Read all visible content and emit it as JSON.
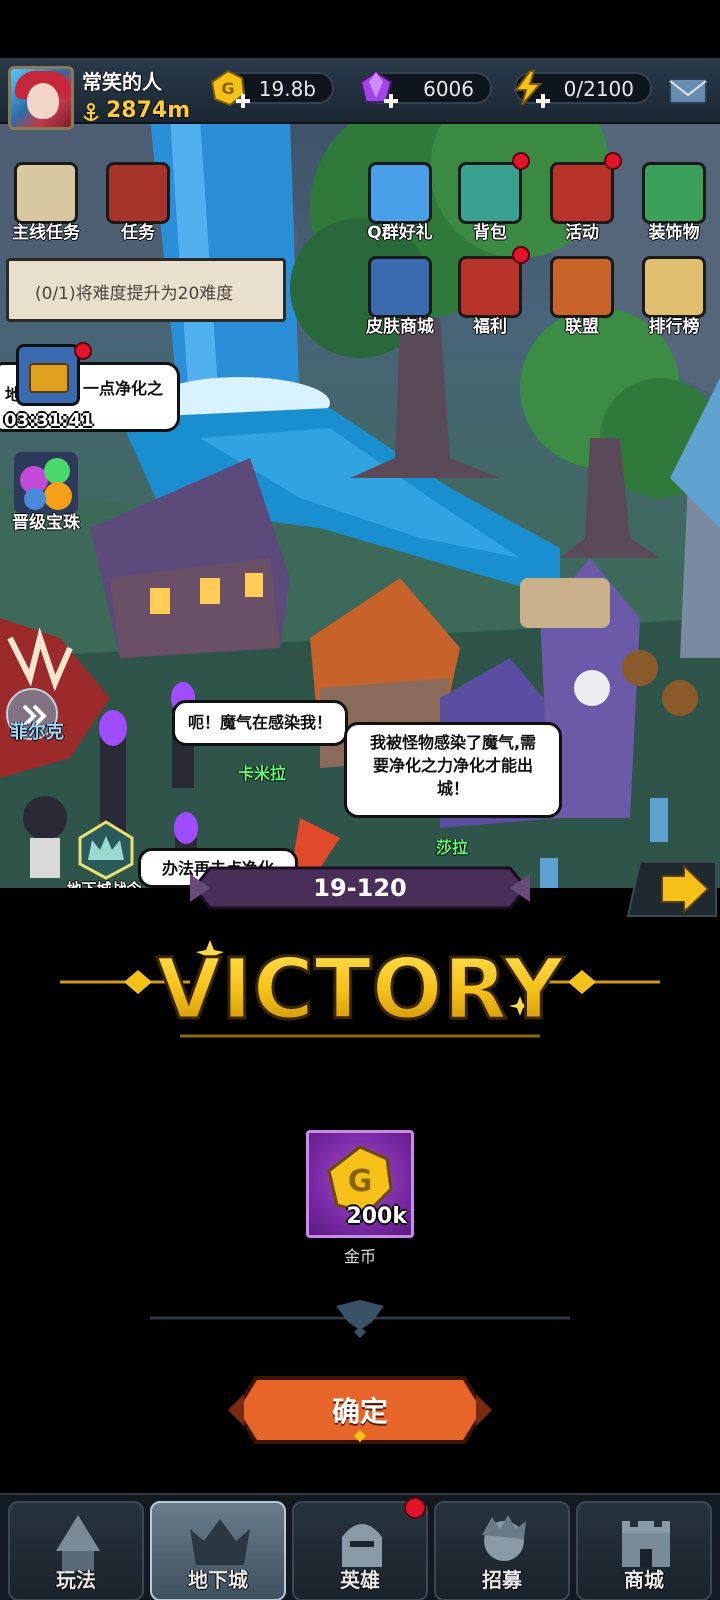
{
  "player": {
    "name": "常笑的人",
    "power": "2874m"
  },
  "resources": {
    "gold": "19.8b",
    "gems": "6006",
    "energy": "0/2100"
  },
  "left_buttons": [
    {
      "label": "主线任务"
    },
    {
      "label": "任务"
    }
  ],
  "quest_tracker": "(0/1)将难度提升为20难度",
  "side_chest": {
    "timer": "03:31:41"
  },
  "upgrade_orbs": {
    "label": "晋级宝珠"
  },
  "right_buttons_row1": [
    {
      "label": "Q群好礼",
      "badge": false
    },
    {
      "label": "背包",
      "badge": true
    },
    {
      "label": "活动",
      "badge": true
    },
    {
      "label": "装饰物",
      "badge": false
    }
  ],
  "right_buttons_row2": [
    {
      "label": "皮肤商城",
      "badge": false
    },
    {
      "label": "福利",
      "badge": true
    },
    {
      "label": "联盟",
      "badge": false
    },
    {
      "label": "排行榜",
      "badge": false
    }
  ],
  "speech": {
    "left_partial_a": "地",
    "left_partial_b": "一点净化之",
    "karila_bubble": "呃！魔气在感染我！",
    "sara_bubble_line1": "我被怪物感染了魔气,需",
    "sara_bubble_line2": "要净化之力净化才能出",
    "sara_bubble_line3": "城！",
    "bottom_partial": "办法再去点净化"
  },
  "npcs": {
    "felix": "菲尔克",
    "karila": "卡米拉",
    "sara": "莎拉"
  },
  "dungeon_pass": "地下城战令",
  "result": {
    "stage": "19-120",
    "title": "VICTORY",
    "reward_amount": "200k",
    "reward_name": "金币",
    "confirm_label": "确定"
  },
  "bottom_nav": [
    {
      "label": "玩法",
      "active": false,
      "badge": false
    },
    {
      "label": "地下城",
      "active": true,
      "badge": false
    },
    {
      "label": "英雄",
      "active": false,
      "badge": true
    },
    {
      "label": "招募",
      "active": false,
      "badge": false
    },
    {
      "label": "商城",
      "active": false,
      "badge": false
    }
  ],
  "colors": {
    "gold_text": "#ffcc33",
    "victory_yellow": "#f6c21a",
    "confirm_orange": "#e8652a",
    "reward_purple": "#7a2aa4",
    "badge_red": "#e3142a"
  }
}
